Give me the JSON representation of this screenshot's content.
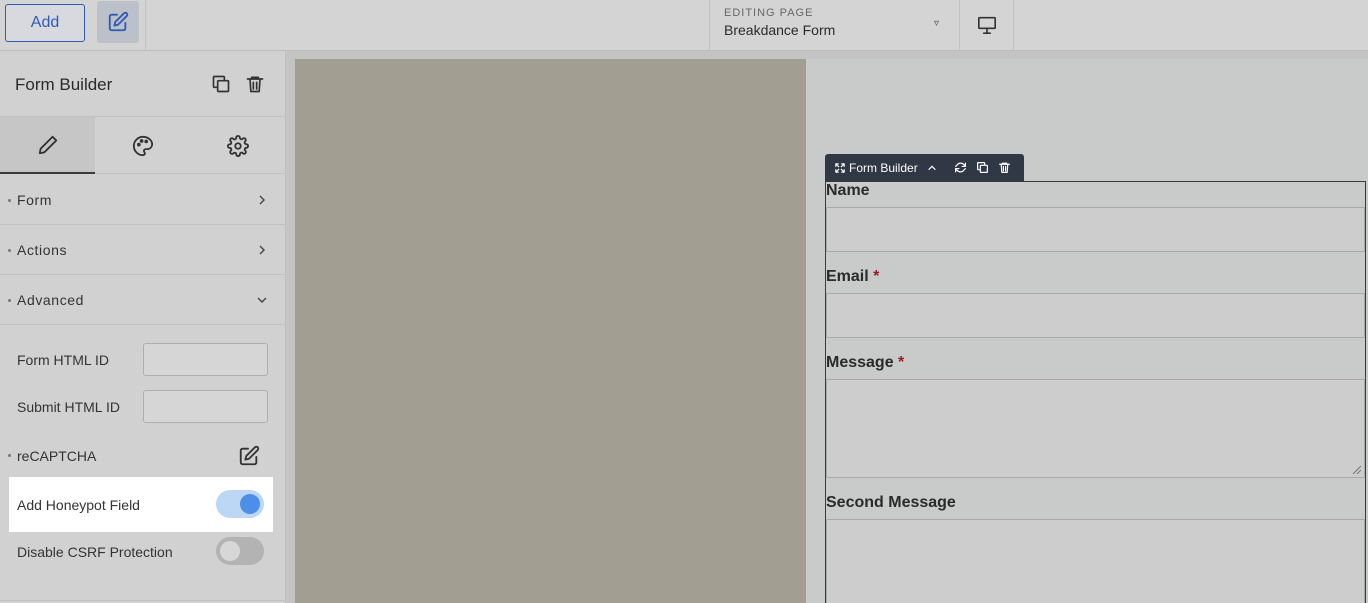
{
  "topbar": {
    "add_label": "Add",
    "editing_label": "EDITING PAGE",
    "editing_value": "Breakdance Form"
  },
  "panel": {
    "title": "Form Builder",
    "tabs": [
      {
        "name": "content",
        "icon": "pencil-icon"
      },
      {
        "name": "style",
        "icon": "palette-icon"
      },
      {
        "name": "settings",
        "icon": "gear-icon"
      }
    ],
    "sections": [
      {
        "label": "Form",
        "expanded": false
      },
      {
        "label": "Actions",
        "expanded": false
      },
      {
        "label": "Advanced",
        "expanded": true
      }
    ],
    "advanced": {
      "form_html_id_label": "Form HTML ID",
      "form_html_id_value": "",
      "submit_html_id_label": "Submit HTML ID",
      "submit_html_id_value": "",
      "recaptcha_label": "reCAPTCHA",
      "honeypot_label": "Add Honeypot Field",
      "honeypot_enabled": true,
      "csrf_label": "Disable CSRF Protection",
      "csrf_enabled": false
    }
  },
  "canvas": {
    "toolbar_label": "Form Builder",
    "fields": [
      {
        "label": "Name",
        "required": false
      },
      {
        "label": "Email",
        "required": true
      },
      {
        "label": "Message",
        "required": true
      },
      {
        "label": "Second Message",
        "required": false
      }
    ],
    "required_marker": "*"
  },
  "colors": {
    "accent": "#2f5ab5",
    "toggle_on": "#4d8fe8",
    "required": "#9a1b1b",
    "toolbar_bg": "#313845"
  }
}
